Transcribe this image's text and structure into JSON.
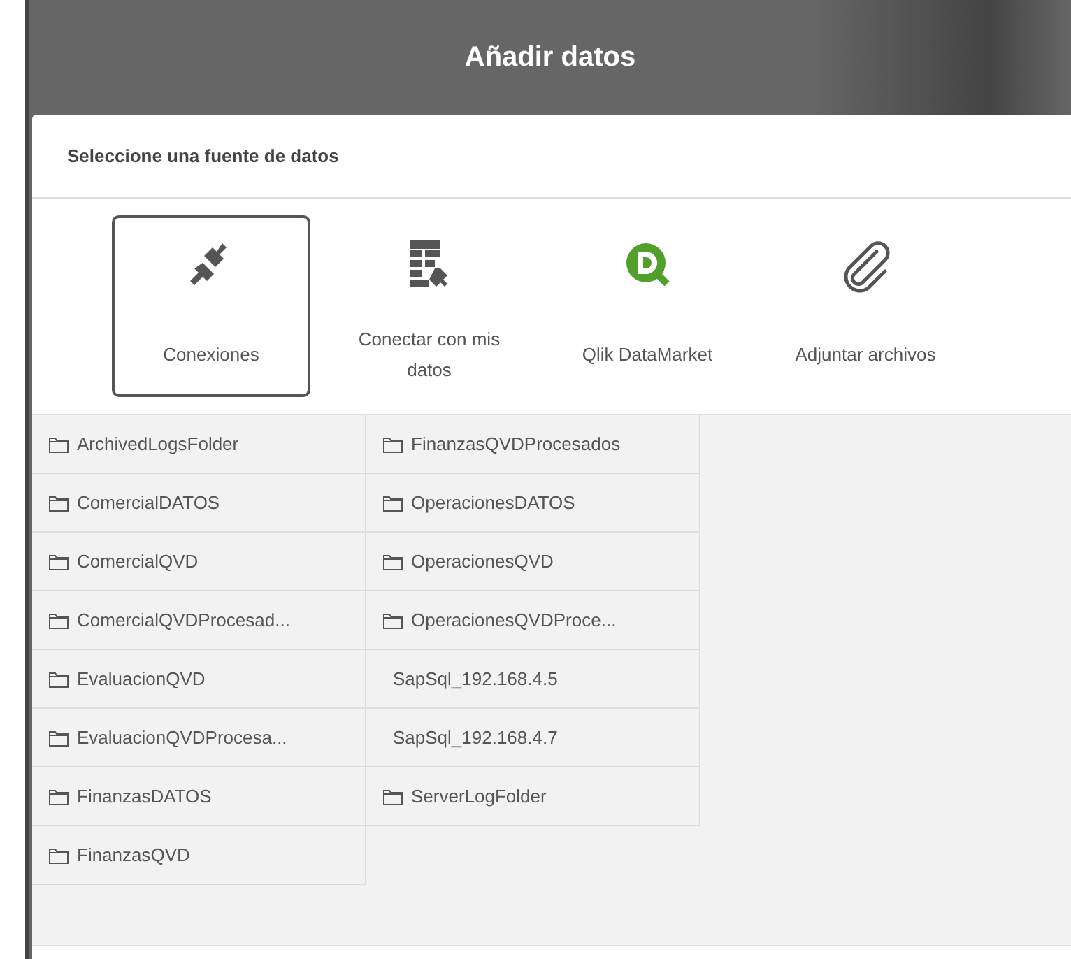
{
  "header": {
    "title": "Añadir datos"
  },
  "panel": {
    "heading": "Seleccione una fuente de datos"
  },
  "sources": [
    {
      "kind": "plug",
      "label": "Conexiones",
      "selected": true
    },
    {
      "kind": "table",
      "label": "Conectar con mis datos",
      "selected": false
    },
    {
      "kind": "datamarket",
      "label": "Qlik DataMarket",
      "selected": false
    },
    {
      "kind": "clip",
      "label": "Adjuntar archivos",
      "selected": false
    }
  ],
  "connections": [
    [
      {
        "kind": "folder",
        "name": "ArchivedLogsFolder"
      },
      {
        "kind": "folder",
        "name": "ComercialDATOS"
      },
      {
        "kind": "folder",
        "name": "ComercialQVD"
      },
      {
        "kind": "folder",
        "name": "ComercialQVDProcesad..."
      },
      {
        "kind": "folder",
        "name": "EvaluacionQVD"
      },
      {
        "kind": "folder",
        "name": "EvaluacionQVDProcesa..."
      },
      {
        "kind": "folder",
        "name": "FinanzasDATOS"
      },
      {
        "kind": "folder",
        "name": "FinanzasQVD"
      }
    ],
    [
      {
        "kind": "folder",
        "name": "FinanzasQVDProcesados"
      },
      {
        "kind": "folder",
        "name": "OperacionesDATOS"
      },
      {
        "kind": "folder",
        "name": "OperacionesQVD"
      },
      {
        "kind": "folder",
        "name": "OperacionesQVDProce..."
      },
      {
        "kind": "database",
        "name": "SapSql_192.168.4.5"
      },
      {
        "kind": "database",
        "name": "SapSql_192.168.4.7"
      },
      {
        "kind": "folder",
        "name": "ServerLogFolder"
      }
    ]
  ]
}
